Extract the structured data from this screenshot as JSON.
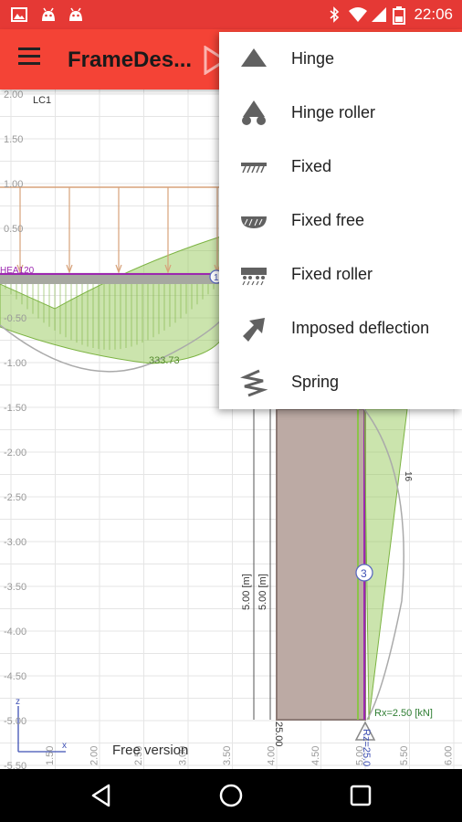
{
  "status_bar": {
    "time": "22:06",
    "icons": [
      "image-icon",
      "android-icon",
      "android-icon",
      "bluetooth-icon",
      "wifi-icon",
      "signal-icon",
      "battery-icon"
    ]
  },
  "app_bar": {
    "title": "FrameDes...",
    "menu_icon": "hamburger-menu-icon",
    "tool_icon": "support-tool-icon"
  },
  "canvas": {
    "load_case": "LC1",
    "watermark": "Free version",
    "y_ticks": [
      "2.00",
      "1.50",
      "1.00",
      "0.50",
      "-0.50",
      "-1.00",
      "-1.50",
      "-2.00",
      "-2.50",
      "-3.00",
      "-3.50",
      "-4.00",
      "-4.50",
      "-5.00",
      "-5.50"
    ],
    "x_ticks": [
      "1.50",
      "2.00",
      "2.50",
      "3.00",
      "3.50",
      "4.00",
      "4.50",
      "5.00",
      "5.50",
      "6.00"
    ],
    "labels": {
      "beam_section": "HEA120",
      "moment_value": "333.73",
      "node_1": "1",
      "node_3": "3",
      "reaction": "Rx=2.50 [kN]",
      "reaction_z": "Rz=25.0",
      "dim_1": "5.00 [m]",
      "dim_2": "5.00 [m]",
      "column_value": "25.00",
      "diagram_value": "16",
      "axis_z": "z",
      "axis_x": "x"
    }
  },
  "support_menu": {
    "items": [
      {
        "label": "Hinge",
        "icon": "hinge-icon"
      },
      {
        "label": "Hinge roller",
        "icon": "hinge-roller-icon"
      },
      {
        "label": "Fixed",
        "icon": "fixed-icon"
      },
      {
        "label": "Fixed free",
        "icon": "fixed-free-icon"
      },
      {
        "label": "Fixed roller",
        "icon": "fixed-roller-icon"
      },
      {
        "label": "Imposed deflection",
        "icon": "imposed-deflection-icon"
      },
      {
        "label": "Spring",
        "icon": "spring-icon"
      }
    ]
  },
  "nav_bar": {
    "back_icon": "back-icon",
    "home_icon": "home-icon",
    "recents_icon": "recents-icon"
  },
  "colors": {
    "status_bar": "#e53935",
    "app_bar": "#f44336",
    "diagram_fill": "#8bc34a",
    "column_fill": "#bcaaa4",
    "load_arrows": "#d7a27a",
    "member": "#9c27b0"
  }
}
